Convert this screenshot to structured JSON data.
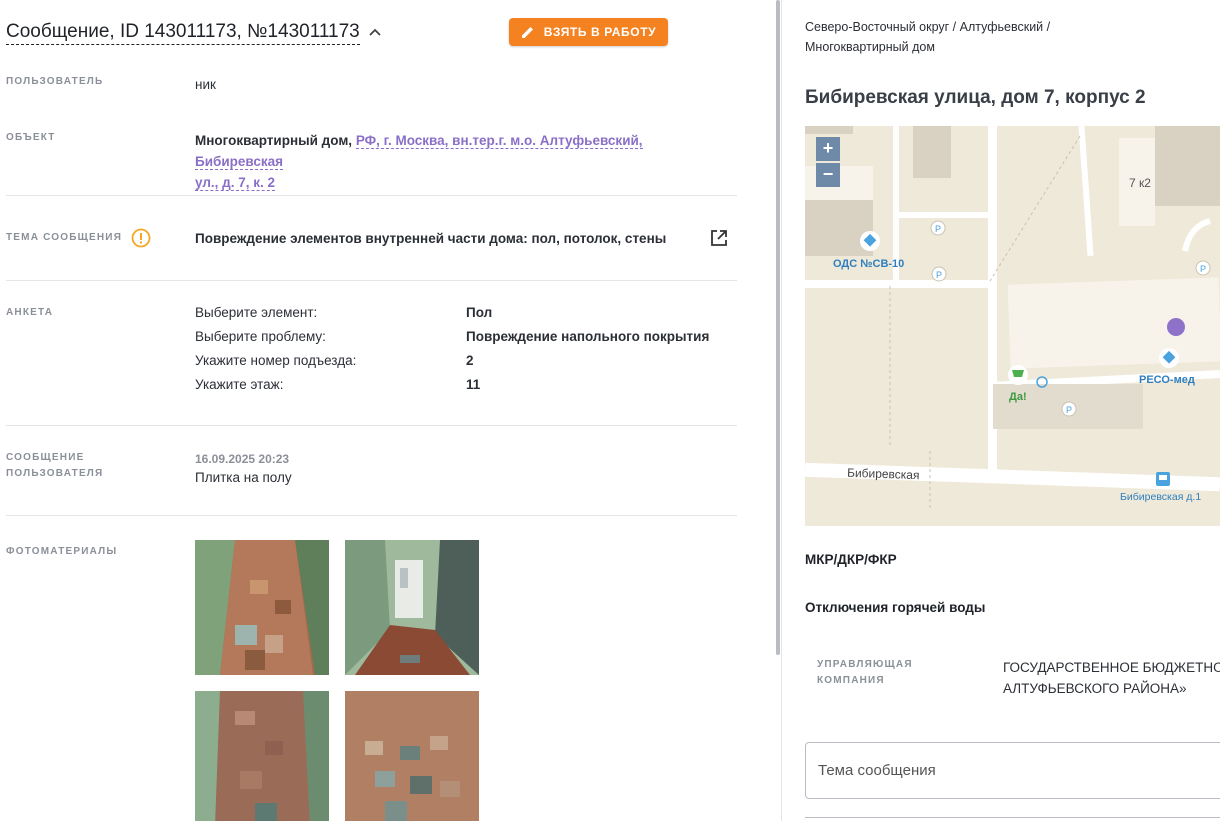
{
  "header": {
    "title": "Сообщение, ID 143011173, №143011173",
    "take_button": "ВЗЯТЬ В РАБОТУ"
  },
  "fields": {
    "user": {
      "label": "ПОЛЬЗОВАТЕЛЬ",
      "value": "ник"
    },
    "object": {
      "label": "ОБЪЕКТ",
      "type": "Многоквартирный дом,",
      "address_line1": "РФ, г. Москва, вн.тер.г. м.о. Алтуфьевский, Бибиревская",
      "address_line2": "ул., д. 7, к. 2"
    },
    "topic": {
      "label": "ТЕМА СООБЩЕНИЯ",
      "value": "Повреждение элементов внутренней части дома: пол, потолок, стены"
    },
    "survey": {
      "label": "АНКЕТА",
      "rows": [
        {
          "q": "Выберите элемент:",
          "a": "Пол"
        },
        {
          "q": "Выберите проблему:",
          "a": "Повреждение напольного покрытия"
        },
        {
          "q": "Укажите номер подъезда:",
          "a": "2"
        },
        {
          "q": "Укажите этаж:",
          "a": "11"
        }
      ]
    },
    "message": {
      "label_line1": "СООБЩЕНИЕ",
      "label_line2": "ПОЛЬЗОВАТЕЛЯ",
      "date": "16.09.2025 20:23",
      "text": "Плитка на полу"
    },
    "photos": {
      "label": "ФОТОМАТЕРИАЛЫ"
    }
  },
  "right": {
    "breadcrumbs_line1": "Северо-Восточный округ / Алтуфьевский /",
    "breadcrumbs_line2": "Многоквартирный дом",
    "address": "Бибиревская улица, дом 7, корпус 2",
    "map": {
      "zoom_in": "+",
      "zoom_out": "−",
      "labels": {
        "building": "7 к2",
        "ods": "ОДС №СВ-10",
        "reso": "РЕСО-мед",
        "da": "Да!",
        "street": "Бибиревская",
        "bus_stop": "Бибиревская д.1",
        "parking": "P"
      }
    },
    "section_mkr": "МКР/ДКР/ФКР",
    "section_hot_water": "Отключения горячей воды",
    "uk_label_line1": "УПРАВЛЯЮЩАЯ",
    "uk_label_line2": "КОМПАНИЯ",
    "uk_value_line1": "ГОСУДАРСТВЕННОЕ БЮДЖЕТНОЕ",
    "uk_value_line2": "АЛТУФЬЕВСКОГО РАЙОНА»",
    "topic_input_placeholder": "Тема сообщения"
  },
  "colors": {
    "accent_orange": "#f58220",
    "link_purple": "#8a6fc7",
    "warning_orange": "#f5a623",
    "map_background": "#efe9d9",
    "map_zoom": "#6f8aa8"
  },
  "icons": {
    "title_toggle": "chevron-up-icon",
    "take_button": "pencil-icon",
    "topic_warning": "warning-circle-icon",
    "topic_open": "open-in-new-icon"
  }
}
